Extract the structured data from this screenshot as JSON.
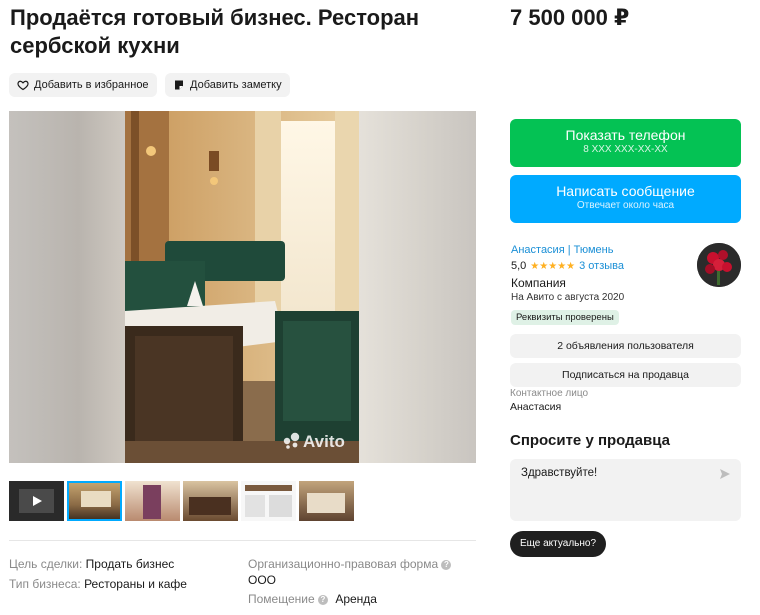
{
  "listing": {
    "title": "Продаётся готовый бизнес. Ресторан сербской кухни",
    "price": "7 500 000 ₽"
  },
  "actions": {
    "favorite_label": "Добавить в избранное",
    "note_label": "Добавить заметку"
  },
  "gallery": {
    "watermark": "Avito",
    "thumbnail_count": 6
  },
  "details": [
    {
      "label": "Цель сделки:",
      "value": "Продать бизнес"
    },
    {
      "label": "Тип бизнеса:",
      "value": "Рестораны и кафе"
    },
    {
      "label": "Организационно-правовая форма",
      "value": "ООО"
    },
    {
      "label": "Помещение",
      "value": "Аренда"
    }
  ],
  "contact_buttons": {
    "phone_label": "Показать телефон",
    "phone_sub": "8 XXX XXX-XX-XX",
    "message_label": "Написать сообщение",
    "message_sub": "Отвечает около часа"
  },
  "seller": {
    "name": "Анастасия | Тюмень",
    "rating": "5,0",
    "stars": "★★★★★",
    "reviews": "3 отзыва",
    "type": "Компания",
    "since": "На Авито с августа 2020",
    "verified_badge": "Реквизиты проверены",
    "listings_button": "2 объявления пользователя",
    "subscribe_button": "Подписаться на продавца",
    "contact_label": "Контактное лицо",
    "contact_name": "Анастасия"
  },
  "ask": {
    "title": "Спросите у продавца",
    "input_value": "Здравствуйте!",
    "quick_reply": "Еще актуально?"
  },
  "colors": {
    "green": "#04c254",
    "blue": "#00aaff",
    "link": "#1a8fd6",
    "star": "#ffb021"
  }
}
